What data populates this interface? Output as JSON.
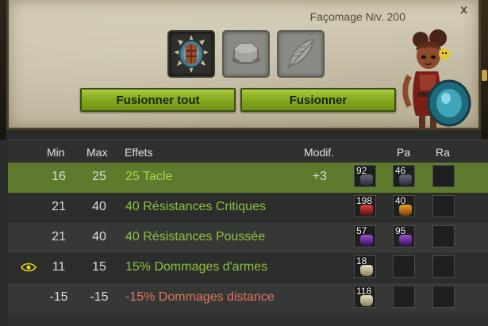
{
  "header": {
    "craft_level": "Façomage Niv. 200",
    "close_label": "x"
  },
  "buttons": {
    "fuse_all": "Fusionner tout",
    "fuse": "Fusionner"
  },
  "columns": {
    "min": "Min",
    "max": "Max",
    "effects": "Effets",
    "modif": "Modif.",
    "pa": "Pa",
    "ra": "Ra"
  },
  "rows": [
    {
      "min": "16",
      "max": "25",
      "effect": "25 Tacle",
      "modif": "+3",
      "rune1": "92",
      "rune2": "46",
      "rune3": "",
      "selected": true
    },
    {
      "min": "21",
      "max": "40",
      "effect": "40 Résistances Critiques",
      "modif": "",
      "rune1": "198",
      "rune2": "40",
      "rune3": ""
    },
    {
      "min": "21",
      "max": "40",
      "effect": "40 Résistances Poussée",
      "modif": "",
      "rune1": "57",
      "rune2": "95",
      "rune3": ""
    },
    {
      "min": "11",
      "max": "15",
      "effect": "15% Dommages d'armes",
      "modif": "",
      "rune1": "18",
      "rune2": "",
      "rune3": ""
    },
    {
      "min": "-15",
      "max": "-15",
      "effect": "-15% Dommages distance",
      "modif": "",
      "rune1": "118",
      "rune2": "",
      "rune3": ""
    }
  ],
  "colors": {
    "accent_green": "#87ab20",
    "effect_positive": "#8ec040",
    "effect_negative": "#e07460",
    "selected_row": "#5e7a2c"
  }
}
